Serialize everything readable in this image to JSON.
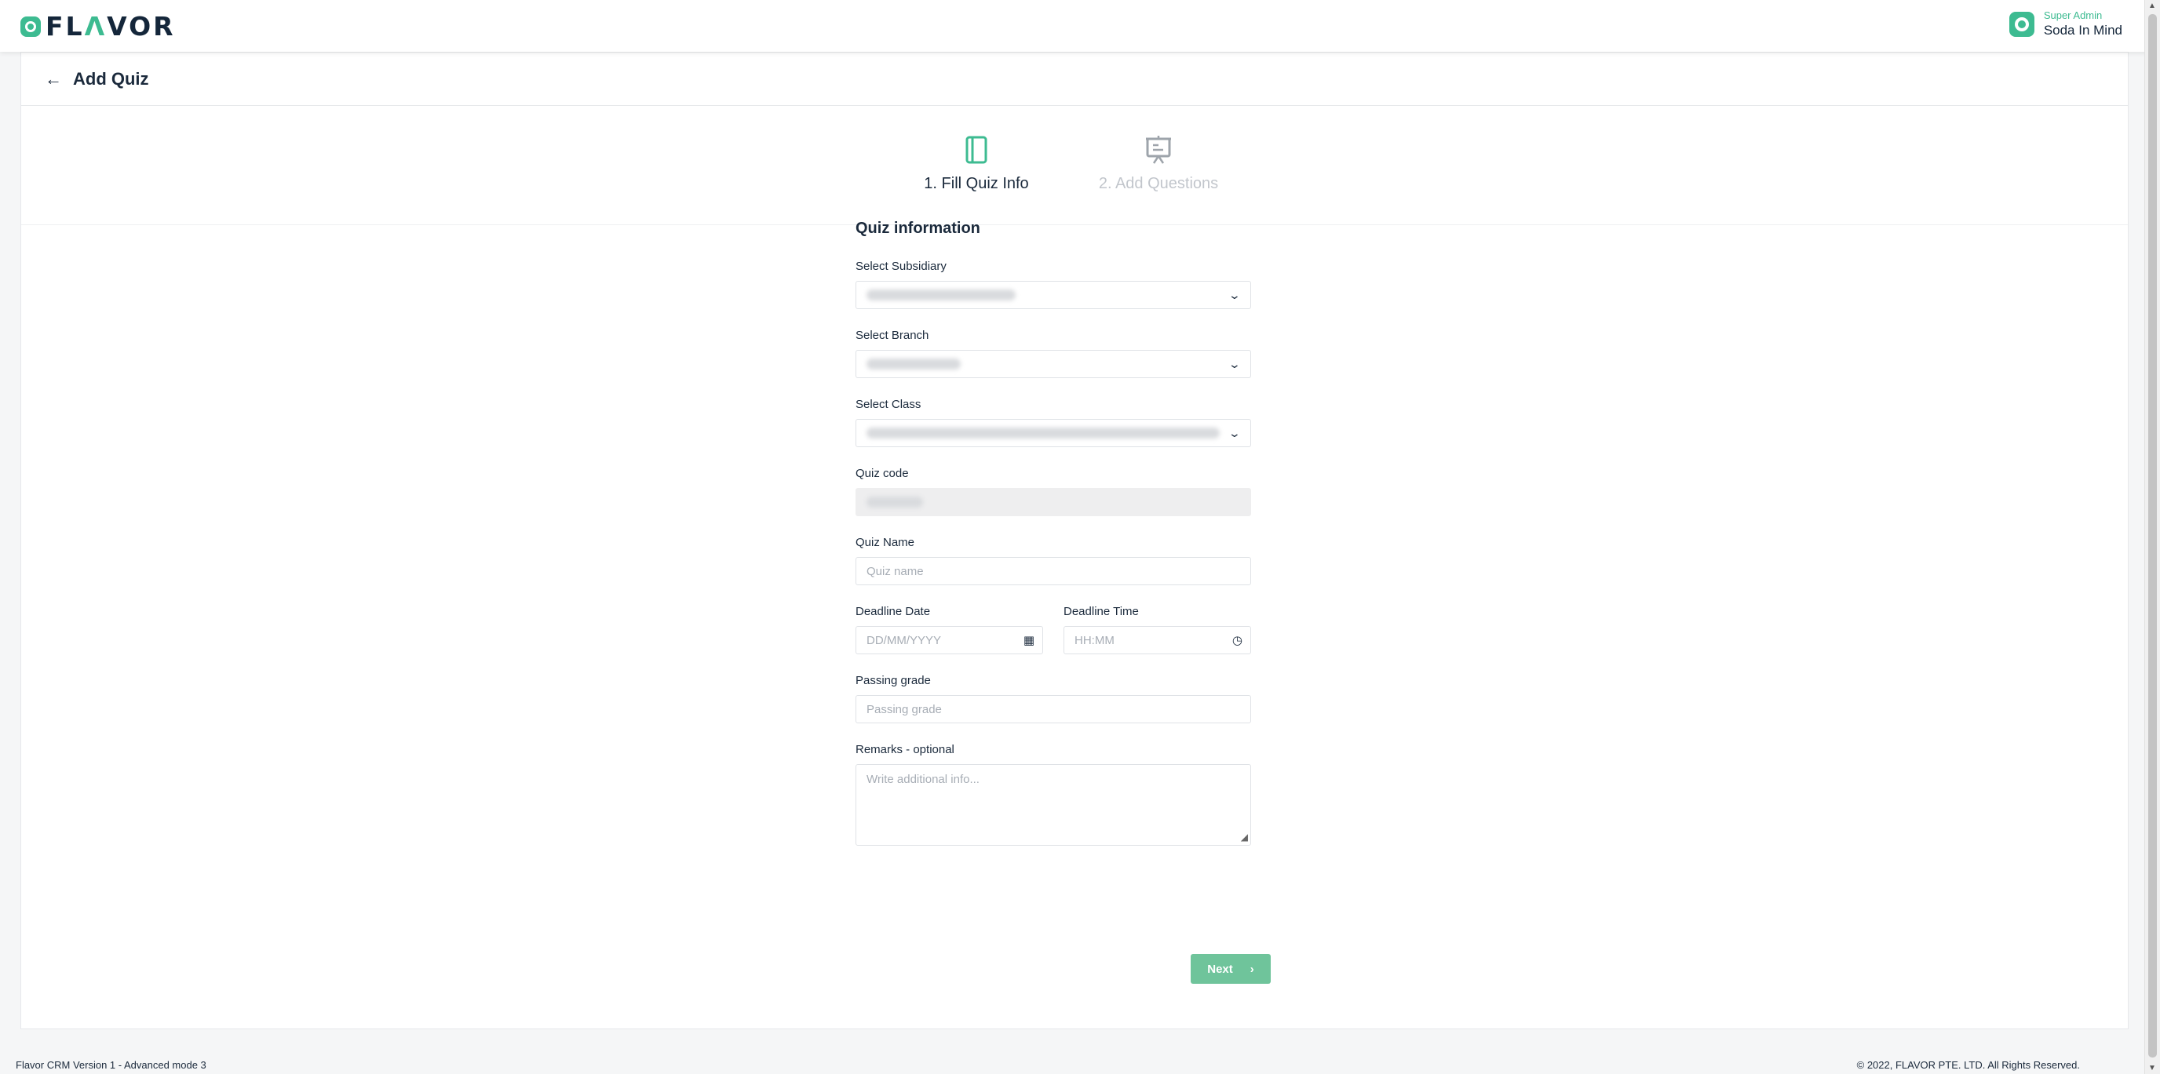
{
  "brand": {
    "name_prefix": "FL",
    "name_accent": "Λ",
    "name_suffix": "VOR",
    "accent_color": "#3dbb91"
  },
  "user": {
    "role": "Super Admin",
    "name": "Soda In Mind"
  },
  "header": {
    "title": "Add Quiz"
  },
  "steps": [
    {
      "label": "1. Fill Quiz Info",
      "state": "active",
      "icon": "notebook-icon"
    },
    {
      "label": "2. Add Questions",
      "state": "inactive",
      "icon": "presentation-board-icon"
    }
  ],
  "form": {
    "title": "Quiz information",
    "subsidiary_label": "Select Subsidiary",
    "branch_label": "Select Branch",
    "class_label": "Select Class",
    "quiz_code_label": "Quiz code",
    "quiz_name_label": "Quiz Name",
    "quiz_name_placeholder": "Quiz name",
    "deadline_date_label": "Deadline Date",
    "deadline_date_placeholder": "DD/MM/YYYY",
    "deadline_time_label": "Deadline Time",
    "deadline_time_placeholder": "HH:MM",
    "passing_grade_label": "Passing grade",
    "passing_grade_placeholder": "Passing grade",
    "remarks_label": "Remarks - optional",
    "remarks_placeholder": "Write additional info..."
  },
  "next_button": "Next",
  "footer": {
    "version": "Flavor CRM Version 1 - Advanced mode 3",
    "copyright": "© 2022, FLAVOR PTE. LTD. All Rights Reserved."
  }
}
